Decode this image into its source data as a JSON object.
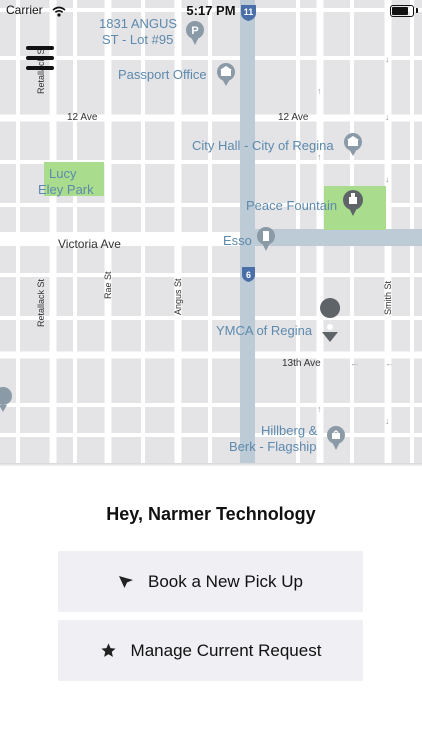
{
  "status_bar": {
    "carrier": "Carrier",
    "time": "5:17 PM",
    "battery_level": 0.9
  },
  "map": {
    "pois": [
      {
        "id": "parking",
        "label_lines": [
          "1831 ANGUS",
          "ST - Lot #95"
        ],
        "icon": "parking-icon"
      },
      {
        "id": "passport",
        "label_lines": [
          "Passport Office"
        ],
        "icon": "museum-icon"
      },
      {
        "id": "cityhall",
        "label_lines": [
          "City Hall - City of Regina"
        ],
        "icon": "museum-icon"
      },
      {
        "id": "fountain",
        "label_lines": [
          "Peace Fountain"
        ],
        "icon": "monument-icon"
      },
      {
        "id": "esso",
        "label_lines": [
          "Esso"
        ],
        "icon": "fuel-icon"
      },
      {
        "id": "ymca",
        "label_lines": [
          "YMCA of Regina"
        ],
        "icon": "map-pin-icon"
      },
      {
        "id": "hillberg",
        "label_lines": [
          "Hillberg &",
          "Berk - Flagship"
        ],
        "icon": "shopping-bag-icon"
      }
    ],
    "parks": [
      {
        "id": "lucy",
        "label_lines": [
          "Lucy",
          "Eley Park"
        ]
      }
    ],
    "streets": [
      {
        "id": "ave12-left",
        "label": "12 Ave"
      },
      {
        "id": "ave12-right",
        "label": "12 Ave"
      },
      {
        "id": "victoria",
        "label": "Victoria Ave"
      },
      {
        "id": "ave13",
        "label": "13th Ave"
      },
      {
        "id": "retallack-top",
        "label": "Retallack St"
      },
      {
        "id": "retallack",
        "label": "Retallack St"
      },
      {
        "id": "rae",
        "label": "Rae St"
      },
      {
        "id": "angus",
        "label": "Angus St"
      },
      {
        "id": "smith",
        "label": "Smith St"
      }
    ],
    "route_shields": [
      "11",
      "6"
    ]
  },
  "panel": {
    "greeting": "Hey, Narmer Technology",
    "buttons": [
      {
        "id": "book",
        "label": "Book a New Pick Up",
        "icon": "location-arrow-icon"
      },
      {
        "id": "manage",
        "label": "Manage Current Request",
        "icon": "star-icon"
      }
    ]
  },
  "colors": {
    "map_background": "#e4e3e6",
    "road": "#ffffff",
    "highway": "#bccbd6",
    "park": "#a9dc8c",
    "poi_label": "#5d8aad",
    "street_label": "#333333",
    "button_background": "#efeff4"
  }
}
